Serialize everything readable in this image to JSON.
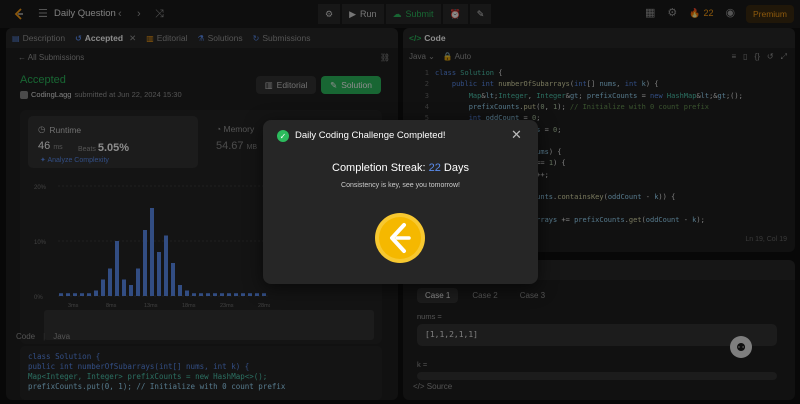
{
  "topbar": {
    "title": "Daily Question",
    "run_label": "Run",
    "submit_label": "Submit",
    "streak_count": "22",
    "premium_label": "Premium"
  },
  "left": {
    "tabs": [
      {
        "label": "Description",
        "active": false
      },
      {
        "label": "Accepted",
        "active": true
      },
      {
        "label": "Editorial",
        "active": false
      },
      {
        "label": "Solutions",
        "active": false
      },
      {
        "label": "Submissions",
        "active": false
      }
    ],
    "all_submissions": "All Submissions",
    "status": "Accepted",
    "user": "CodingLagg",
    "submitted_text": "submitted at Jun 22, 2024 15:30",
    "editorial_btn": "Editorial",
    "solution_btn": "Solution",
    "runtime_label": "Runtime",
    "runtime_value": "46",
    "runtime_unit": "ms",
    "beats_label": "Beats",
    "beats_value": "5.05%",
    "analyze_label": "Analyze Complexity",
    "memory_label": "Memory",
    "memory_value": "54.67",
    "memory_unit": "MB",
    "code_tab": "Code",
    "code_lang": "Java",
    "code_preview": [
      "class Solution {",
      "    public int numberOfSubarrays(int[] nums, int k) {",
      "        Map<Integer, Integer> prefixCounts = new HashMap<>();",
      "        prefixCounts.put(0, 1); // Initialize with 0 count prefix"
    ]
  },
  "chart_data": {
    "type": "bar",
    "ylabels": [
      "20%",
      "10%",
      "0%"
    ],
    "xlabels": [
      "3ms",
      "8ms",
      "13ms",
      "18ms",
      "23ms",
      "28ms"
    ],
    "values": [
      0.5,
      0.5,
      0.5,
      0.5,
      0.5,
      1,
      3,
      5,
      10,
      3,
      2,
      5,
      12,
      16,
      8,
      11,
      6,
      2,
      1,
      0.5,
      0.5,
      0.5,
      0.5,
      0.5,
      0.5,
      0.5,
      0.5,
      0.5,
      0.5,
      0.5
    ],
    "ylim": [
      0,
      20
    ],
    "highlight_color": "#5b8def"
  },
  "editor": {
    "title": "Code",
    "lang": "Java",
    "auto": "Auto",
    "position": "Ln 19, Col 19",
    "lines": [
      {
        "n": "1",
        "t": "class Solution {"
      },
      {
        "n": "2",
        "t": "    public int numberOfSubarrays(int[] nums, int k) {"
      },
      {
        "n": "3",
        "t": "        Map<Integer, Integer> prefixCounts = new HashMap<>();"
      },
      {
        "n": "4",
        "t": "        prefixCounts.put(0, 1); // Initialize with 0 count prefix"
      },
      {
        "n": "5",
        "t": "        int oddCount = 0;"
      },
      {
        "n": "6",
        "t": "        int niceSubarrays = 0;"
      },
      {
        "n": "7",
        "t": ""
      },
      {
        "n": "8",
        "t": "        for (int num : nums) {"
      },
      {
        "n": "9",
        "t": "            if (num % 2 == 1) {"
      },
      {
        "n": "10",
        "t": "                oddCount++;"
      },
      {
        "n": "11",
        "t": "            }"
      },
      {
        "n": "12",
        "t": "            if (prefixCounts.containsKey(oddCount - k)) {"
      },
      {
        "n": "13",
        "t": ""
      },
      {
        "n": "14",
        "t": "                niceSubarrays += prefixCounts.get(oddCount - k);"
      }
    ]
  },
  "testcase": {
    "cases": [
      "Case 1",
      "Case 2",
      "Case 3"
    ],
    "nums_label": "nums =",
    "nums_value": "[1,1,2,1,1]",
    "k_label": "k =",
    "source_label": "Source"
  },
  "modal": {
    "title": "Daily Coding Challenge Completed!",
    "streak_prefix": "Completion Streak:",
    "streak_num": "22",
    "streak_suffix": "Days",
    "subtitle": "Consistency is key, see you tomorrow!"
  }
}
